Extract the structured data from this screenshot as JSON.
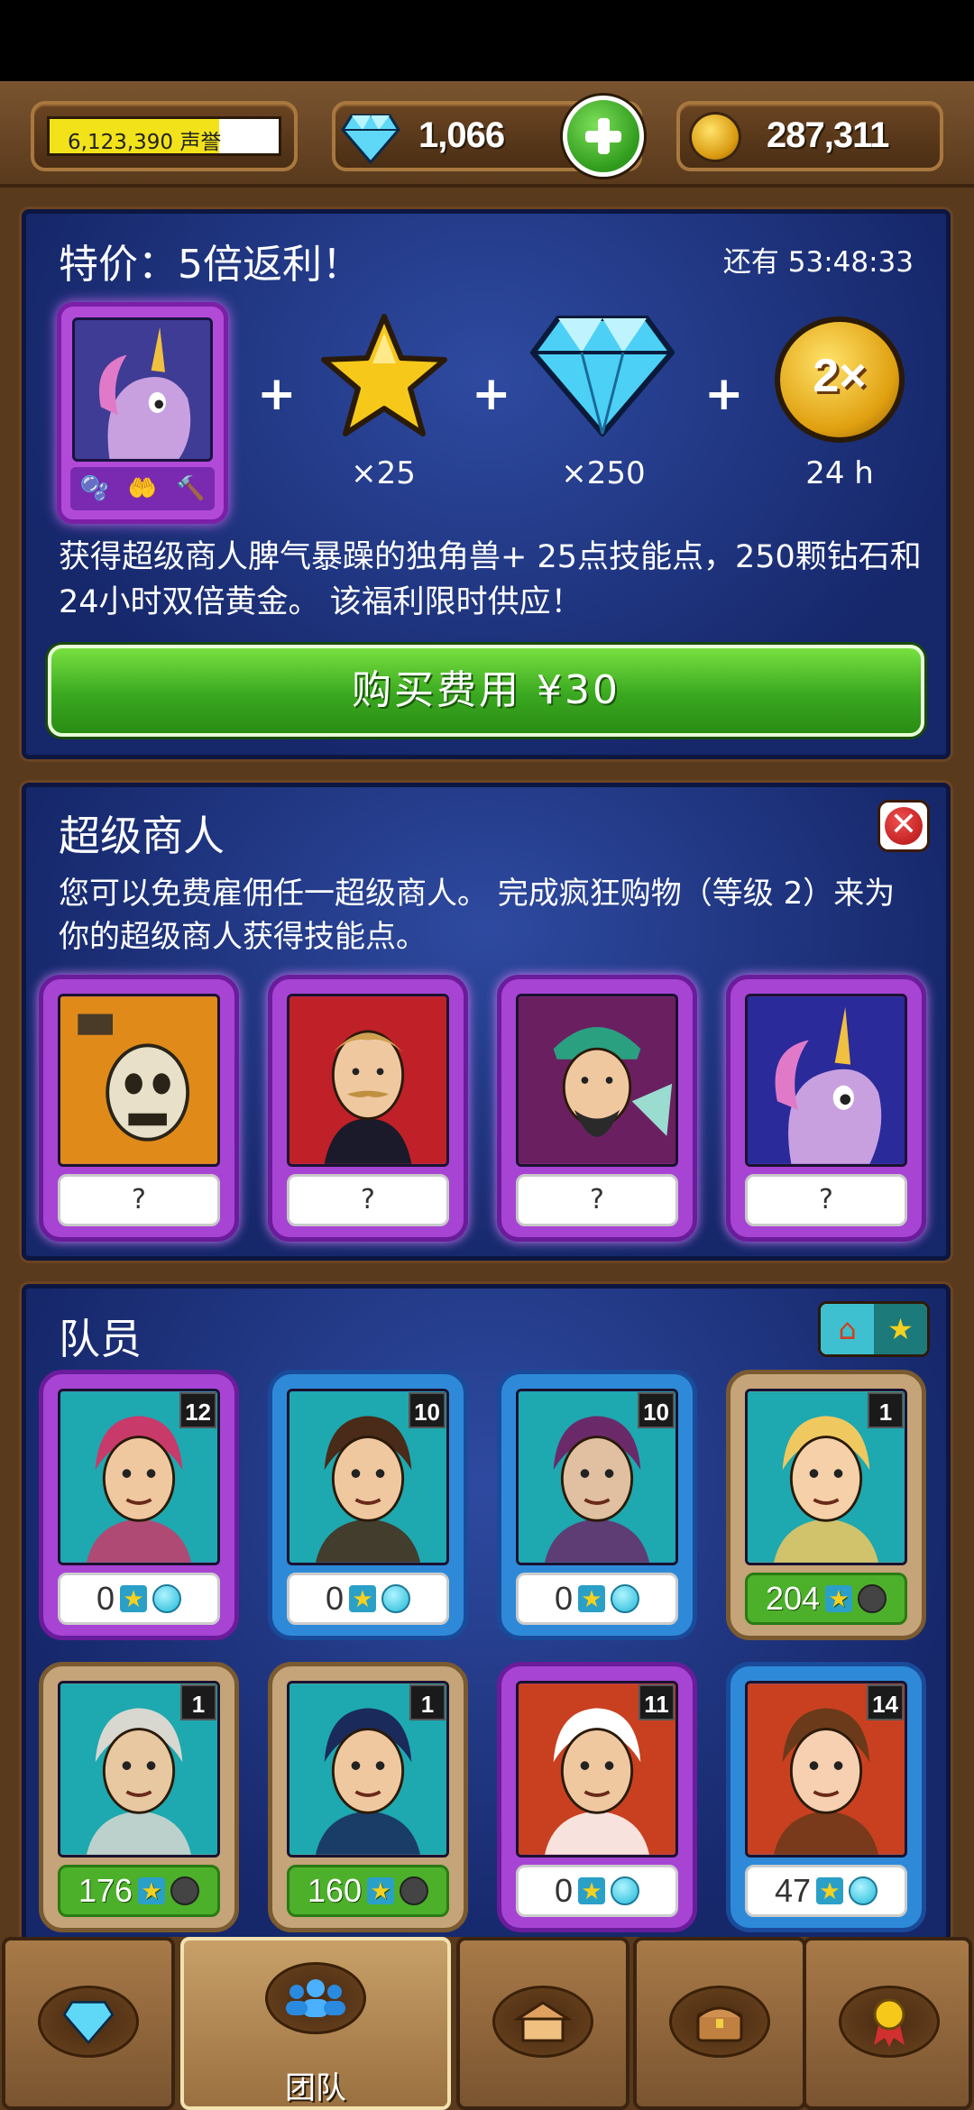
{
  "header": {
    "reputation_value": "6,123,390",
    "reputation_unit": "声誉",
    "reputation_fill": 0.74,
    "gems_value": "1,066",
    "gold_value": "287,311"
  },
  "offer": {
    "title": "特价：5倍返利！",
    "timer": "还有 53:48:33",
    "rewards": [
      {
        "icon": "star-icon",
        "label": "×25"
      },
      {
        "icon": "diamond-icon",
        "label": "×250"
      },
      {
        "icon": "double-gold-icon",
        "badge": "2×",
        "label": "24 h"
      }
    ],
    "description": "获得超级商人脾气暴躁的独角兽+ 25点技能点，250颗钻石和24小时双倍黄金。 该福利限时供应！",
    "buy_label": "购买费用 ¥30"
  },
  "merchants": {
    "title": "超级商人",
    "description": "您可以免费雇佣任一超级商人。 完成疯狂购物（等级 2）来为你的超级商人获得技能点。",
    "cards": [
      {
        "portrait": "skeleton-portrait",
        "label": "?"
      },
      {
        "portrait": "gentleman-portrait",
        "label": "?"
      },
      {
        "portrait": "warlord-portrait",
        "label": "?"
      },
      {
        "portrait": "unicorn-portrait",
        "label": "?"
      }
    ]
  },
  "team": {
    "title": "队员",
    "members": [
      {
        "portrait": "elf-alchemist-portrait",
        "level": "12",
        "points": "0",
        "frame": "purple",
        "status": "cyan"
      },
      {
        "portrait": "bearded-noble-portrait",
        "level": "10",
        "points": "0",
        "frame": "blue",
        "status": "cyan"
      },
      {
        "portrait": "dreadlock-elf-portrait",
        "level": "10",
        "points": "0",
        "frame": "blue",
        "status": "cyan"
      },
      {
        "portrait": "potion-lady-portrait",
        "level": "1",
        "points": "204",
        "frame": "tan",
        "status": "gray"
      },
      {
        "portrait": "old-wizard-portrait",
        "level": "1",
        "points": "176",
        "frame": "tan",
        "status": "gray"
      },
      {
        "portrait": "general-portrait",
        "level": "1",
        "points": "160",
        "frame": "tan",
        "status": "gray"
      },
      {
        "portrait": "chef-portrait",
        "level": "11",
        "points": "0",
        "frame": "purple",
        "status": "cyan"
      },
      {
        "portrait": "baker-lady-portrait",
        "level": "14",
        "points": "47",
        "frame": "blue",
        "status": "cyan"
      }
    ]
  },
  "bottom_nav": {
    "tabs": [
      {
        "icon": "diamond-icon",
        "label": ""
      },
      {
        "icon": "team-icon",
        "label": "团队"
      },
      {
        "icon": "shop-icon",
        "label": ""
      },
      {
        "icon": "treasure-chest-icon",
        "label": ""
      },
      {
        "icon": "medal-icon",
        "label": ""
      }
    ]
  }
}
